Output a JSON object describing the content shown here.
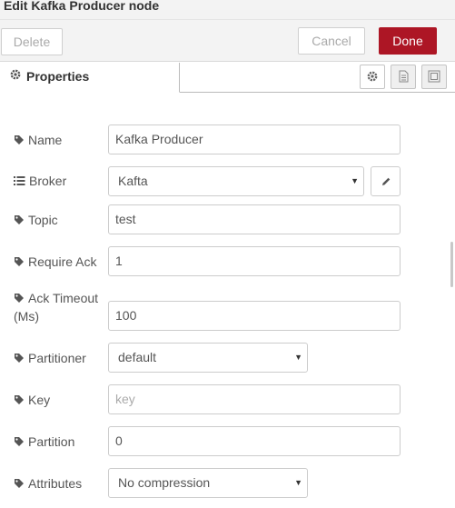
{
  "window": {
    "title": "Edit Kafka Producer node"
  },
  "toolbar": {
    "delete_label": "Delete",
    "cancel_label": "Cancel",
    "done_label": "Done"
  },
  "tabs": {
    "properties_label": "Properties"
  },
  "form": {
    "name": {
      "label": "Name",
      "value": "Kafka Producer"
    },
    "broker": {
      "label": "Broker",
      "value": "Kafta"
    },
    "topic": {
      "label": "Topic",
      "value": "test"
    },
    "require_ack": {
      "label": "Require Ack",
      "value": "1"
    },
    "ack_timeout": {
      "label_line1": "Ack Timeout",
      "label_line2": "(Ms)",
      "value": "100"
    },
    "partitioner": {
      "label": "Partitioner",
      "value": "default"
    },
    "key": {
      "label": "Key",
      "placeholder": "key",
      "value": ""
    },
    "partition": {
      "label": "Partition",
      "value": "0"
    },
    "attributes": {
      "label": "Attributes",
      "value": "No compression"
    }
  },
  "icons": {
    "tab_settings": "gear-icon",
    "tab_description": "document-icon",
    "tab_appearance": "frame-icon",
    "field_tag": "tag-icon",
    "broker": "list-icon",
    "edit": "pencil-icon",
    "dropdown": "caret-down-icon"
  },
  "colors": {
    "done_button": "#ad1625",
    "toolbar_bg": "#f3f3f3"
  }
}
